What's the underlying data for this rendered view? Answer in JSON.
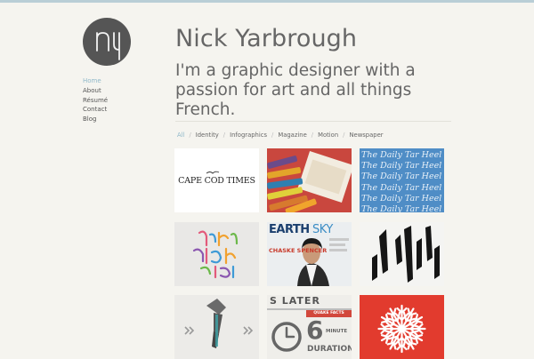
{
  "site": {
    "logo_text": "ny",
    "name": "Nick Yarbrough",
    "tagline": "I'm a graphic designer with a passion for art and all things French."
  },
  "nav": {
    "items": [
      {
        "label": "Home",
        "active": true
      },
      {
        "label": "About"
      },
      {
        "label": "Résumé"
      },
      {
        "label": "Contact"
      },
      {
        "label": "Blog"
      }
    ]
  },
  "filters": {
    "items": [
      {
        "label": "All",
        "active": true
      },
      {
        "label": "Identity"
      },
      {
        "label": "Infographics"
      },
      {
        "label": "Magazine"
      },
      {
        "label": "Motion"
      },
      {
        "label": "Newspaper"
      }
    ],
    "separator": "/"
  },
  "portfolio": {
    "tiles": [
      {
        "caption": "CAPE COD TIMES"
      },
      {
        "caption": ""
      },
      {
        "caption": "The Daily Tar Heel"
      },
      {
        "caption": ""
      },
      {
        "caption": "EARTH",
        "caption2": "SKY",
        "caption3": "CHASKE SPENCER"
      },
      {
        "caption": ""
      },
      {
        "caption": ""
      },
      {
        "caption": "S LATER",
        "caption2": "QUAKE FACTS",
        "caption3": "6",
        "caption4": "MINUTE",
        "caption5": "DURATION"
      },
      {
        "caption": ""
      }
    ]
  },
  "colors": {
    "accent": "#8fb8c9",
    "background": "#f5f4ef",
    "text": "#555555",
    "logo_bg": "#555555"
  }
}
